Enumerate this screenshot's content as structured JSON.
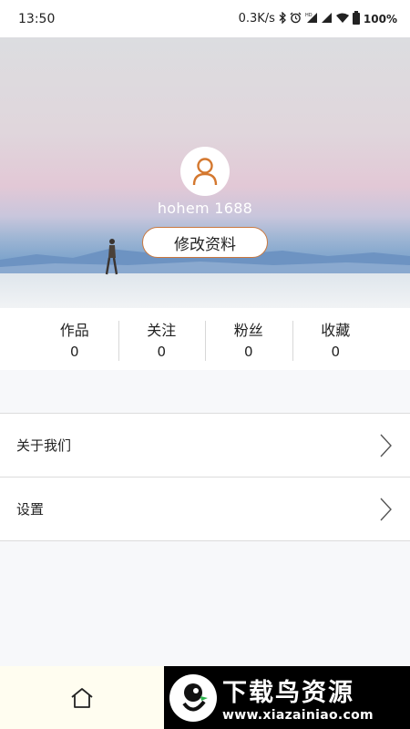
{
  "status_bar": {
    "time": "13:50",
    "net_speed": "0.3K/s",
    "battery": "100%",
    "icons": [
      "bluetooth-icon",
      "alarm-icon",
      "hd-signal-icon",
      "signal-icon",
      "wifi-icon",
      "battery-icon"
    ]
  },
  "profile": {
    "username": "hohem 1688",
    "edit_label": "修改资料",
    "avatar_icon": "user-icon"
  },
  "stats": [
    {
      "label": "作品",
      "value": "0"
    },
    {
      "label": "关注",
      "value": "0"
    },
    {
      "label": "粉丝",
      "value": "0"
    },
    {
      "label": "收藏",
      "value": "0"
    }
  ],
  "menu": [
    {
      "label": "关于我们",
      "icon": "chevron-right-icon"
    },
    {
      "label": "设置",
      "icon": "chevron-right-icon"
    }
  ],
  "bottom_nav": {
    "home_icon": "home-icon"
  },
  "watermark": {
    "title": "下载鸟资源",
    "url": "www.xiazainiao.com"
  },
  "colors": {
    "accent": "#c9783f",
    "background": "#f7f8fa"
  }
}
